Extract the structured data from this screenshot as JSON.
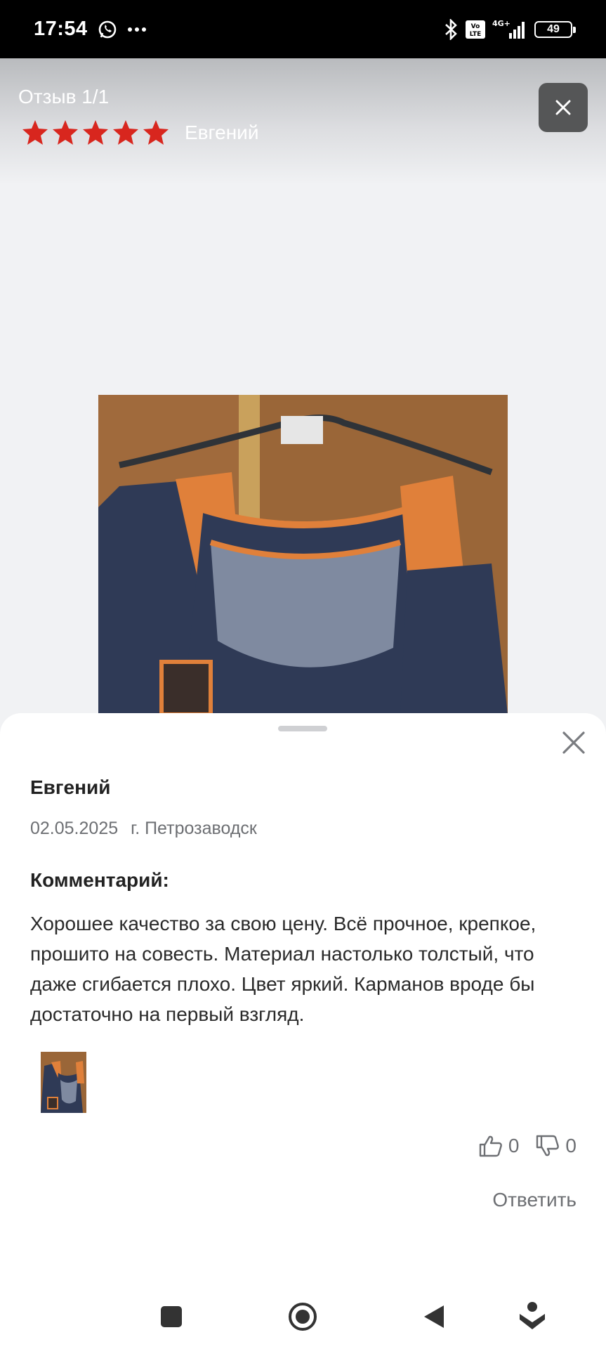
{
  "status_bar": {
    "time": "17:54",
    "network": "4G+",
    "volte": "Vo LTE",
    "battery": "49"
  },
  "viewer": {
    "counter": "Отзыв 1/1",
    "rating": 5,
    "author": "Евгений"
  },
  "review": {
    "author": "Евгений",
    "date": "02.05.2025",
    "city": "г. Петрозаводск",
    "comment_label": "Комментарий:",
    "comment": "Хорошее качество за свою цену. Всё прочное, крепкое, прошито на совесть. Материал настолько толстый, что даже сгибается плохо. Цвет яркий. Карманов вроде бы достаточно на первый взгляд.",
    "likes": "0",
    "dislikes": "0",
    "reply_label": "Ответить"
  },
  "colors": {
    "star": "#d8261e",
    "vest_orange": "#e0803a",
    "vest_navy": "#2f3a56"
  },
  "icons": [
    "whatsapp-icon",
    "more-icon",
    "bluetooth-icon",
    "signal-icon",
    "battery-icon",
    "star-icon",
    "close-icon",
    "thumbs-up-icon",
    "thumbs-down-icon",
    "square-nav-icon",
    "home-nav-icon",
    "back-nav-icon",
    "assistant-nav-icon"
  ]
}
